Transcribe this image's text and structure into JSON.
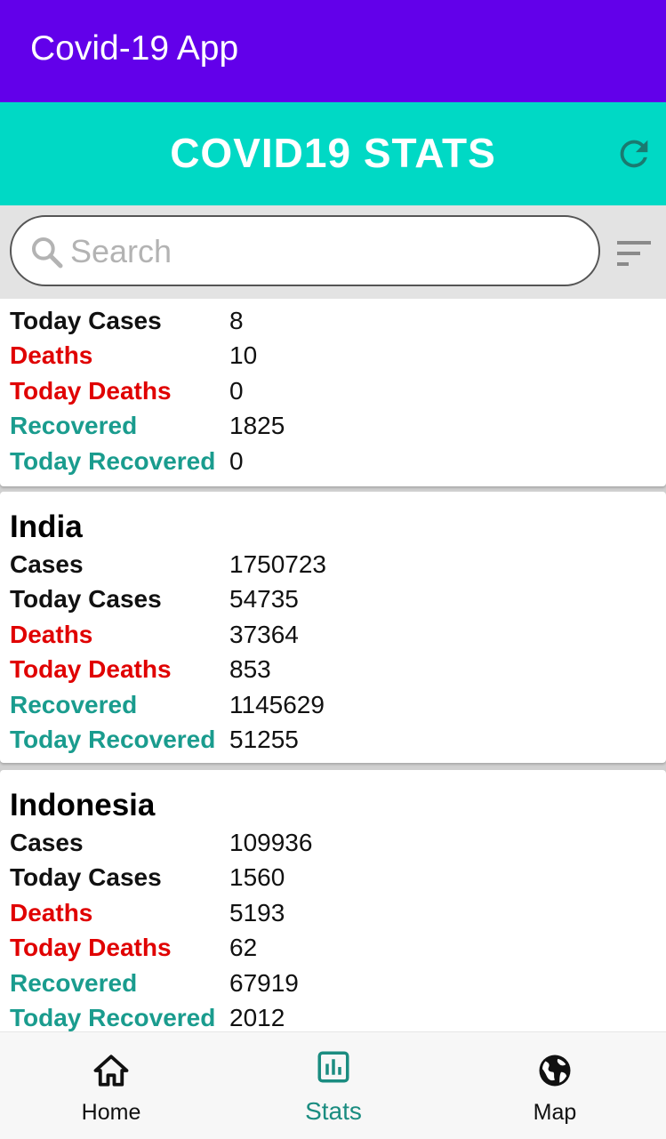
{
  "app": {
    "title": "Covid-19 App"
  },
  "header": {
    "title": "COVID19 STATS",
    "refresh_icon": "refresh-icon"
  },
  "search": {
    "placeholder": "Search",
    "value": "",
    "search_icon": "search-icon",
    "sort_icon": "sort-icon"
  },
  "colors": {
    "appbar": "#6200ea",
    "header": "#00d9c5",
    "red": "#e00000",
    "teal": "#1a9c8e"
  },
  "cards": [
    {
      "country": "",
      "rows": [
        {
          "label": "Today Cases",
          "value": "8",
          "color": "black"
        },
        {
          "label": "Deaths",
          "value": "10",
          "color": "red"
        },
        {
          "label": "Today Deaths",
          "value": "0",
          "color": "red"
        },
        {
          "label": "Recovered",
          "value": "1825",
          "color": "teal"
        },
        {
          "label": "Today Recovered",
          "value": "0",
          "color": "teal"
        }
      ]
    },
    {
      "country": "India",
      "rows": [
        {
          "label": "Cases",
          "value": "1750723",
          "color": "black"
        },
        {
          "label": "Today Cases",
          "value": "54735",
          "color": "black"
        },
        {
          "label": "Deaths",
          "value": "37364",
          "color": "red"
        },
        {
          "label": "Today Deaths",
          "value": "853",
          "color": "red"
        },
        {
          "label": "Recovered",
          "value": "1145629",
          "color": "teal"
        },
        {
          "label": "Today Recovered",
          "value": "51255",
          "color": "teal"
        }
      ]
    },
    {
      "country": "Indonesia",
      "rows": [
        {
          "label": "Cases",
          "value": "109936",
          "color": "black"
        },
        {
          "label": "Today Cases",
          "value": "1560",
          "color": "black"
        },
        {
          "label": "Deaths",
          "value": "5193",
          "color": "red"
        },
        {
          "label": "Today Deaths",
          "value": "62",
          "color": "red"
        },
        {
          "label": "Recovered",
          "value": "67919",
          "color": "teal"
        },
        {
          "label": "Today Recovered",
          "value": "2012",
          "color": "teal"
        }
      ]
    }
  ],
  "bottom_nav": [
    {
      "label": "Home",
      "icon": "home-icon",
      "active": false
    },
    {
      "label": "Stats",
      "icon": "stats-icon",
      "active": true
    },
    {
      "label": "Map",
      "icon": "globe-icon",
      "active": false
    }
  ]
}
